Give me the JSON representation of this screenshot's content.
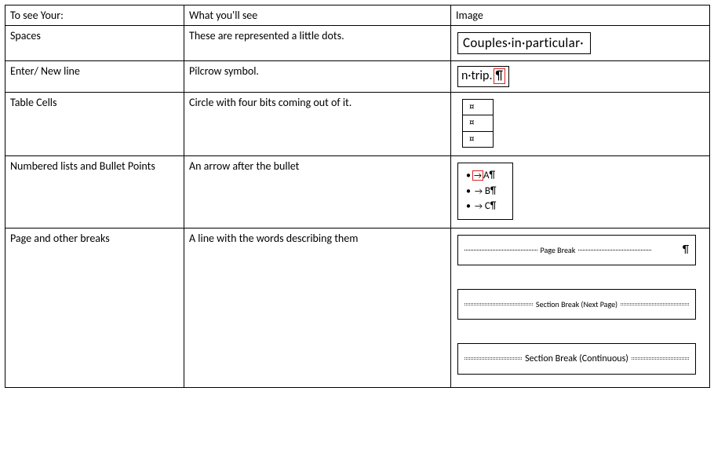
{
  "headers": {
    "col1": "To see Your:",
    "col2": "What you'll see",
    "col3": "Image"
  },
  "rows": {
    "spaces": {
      "name": "Spaces",
      "desc": "These are represented a little dots.",
      "sample": "Couples·in·particular·"
    },
    "enter": {
      "name": "Enter/ New line",
      "desc": "Pilcrow symbol.",
      "sample_pre": "n·trip.",
      "sample_mark": "¶"
    },
    "tablecells": {
      "name": "Table Cells",
      "desc": "Circle with four bits coming out of it.",
      "mark": "¤"
    },
    "bullets": {
      "name": "Numbered lists and Bullet Points",
      "desc": "An arrow after the bullet",
      "items": {
        "a": "A¶",
        "b": "B¶",
        "c": "C¶"
      },
      "bullet": "•",
      "arrow": "→"
    },
    "breaks": {
      "name": "Page and other breaks",
      "desc": "A line with the words describing them",
      "page_break": "Page Break",
      "pilcrow": "¶",
      "section_next": "Section Break (Next Page)",
      "section_cont": "Section Break (Continuous)"
    }
  }
}
